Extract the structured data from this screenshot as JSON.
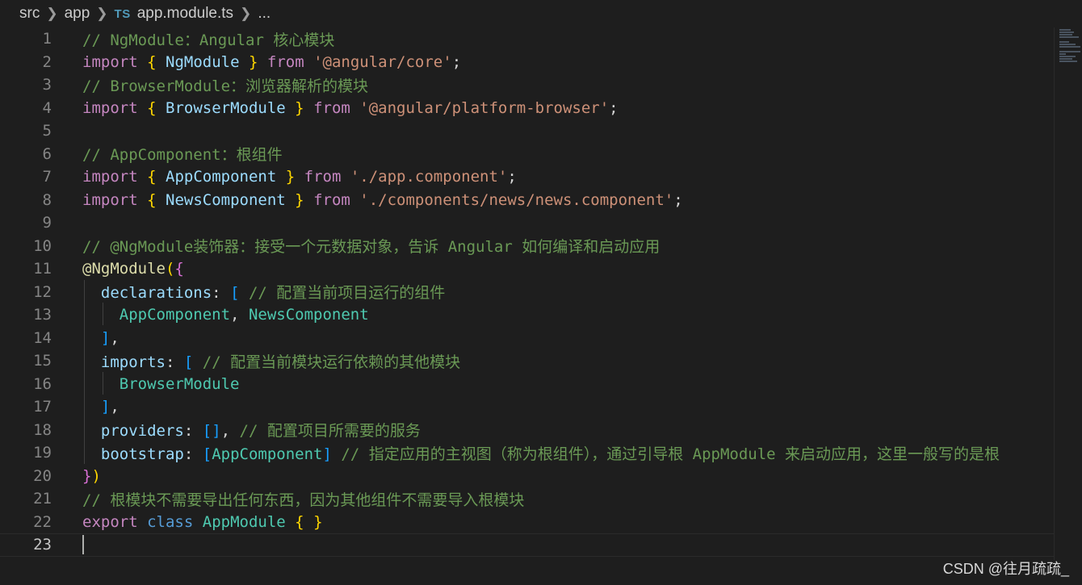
{
  "breadcrumb": {
    "seg1": "src",
    "seg2": "app",
    "file_icon": "TS",
    "file": "app.module.ts",
    "more": "..."
  },
  "gutter": {
    "numbers": [
      "1",
      "2",
      "3",
      "4",
      "5",
      "6",
      "7",
      "8",
      "9",
      "10",
      "11",
      "12",
      "13",
      "14",
      "15",
      "16",
      "17",
      "18",
      "19",
      "20",
      "21",
      "22",
      "23"
    ]
  },
  "code": {
    "l1": "// NgModule：Angular 核心模块",
    "l2": {
      "kw": "import",
      "ob": "{",
      "name": "NgModule",
      "cb": "}",
      "from": "from",
      "str": "'@angular/core'",
      "end": ";"
    },
    "l3": "// BrowserModule：浏览器解析的模块",
    "l4": {
      "kw": "import",
      "ob": "{",
      "name": "BrowserModule",
      "cb": "}",
      "from": "from",
      "str": "'@angular/platform-browser'",
      "end": ";"
    },
    "l6": "// AppComponent：根组件",
    "l7": {
      "kw": "import",
      "ob": "{",
      "name": "AppComponent",
      "cb": "}",
      "from": "from",
      "str": "'./app.component'",
      "end": ";"
    },
    "l8": {
      "kw": "import",
      "ob": "{",
      "name": "NewsComponent",
      "cb": "}",
      "from": "from",
      "str": "'./components/news/news.component'",
      "end": ";"
    },
    "l10": "// @NgModule装饰器：接受一个元数据对象，告诉 Angular 如何编译和启动应用",
    "l11": {
      "at": "@",
      "fn": "NgModule",
      "op": "(",
      "ob": "{"
    },
    "l12": {
      "prop": "declarations",
      "colon": ":",
      "br": "[",
      "cm": "// 配置当前项目运行的组件"
    },
    "l13": {
      "a": "AppComponent",
      "comma": ",",
      "b": "NewsComponent"
    },
    "l14": {
      "br": "]",
      "comma": ","
    },
    "l15": {
      "prop": "imports",
      "colon": ":",
      "br": "[",
      "cm": "// 配置当前模块运行依赖的其他模块"
    },
    "l16": {
      "a": "BrowserModule"
    },
    "l17": {
      "br": "]",
      "comma": ","
    },
    "l18": {
      "prop": "providers",
      "colon": ":",
      "br": "[]",
      "comma": ",",
      "cm": "// 配置项目所需要的服务"
    },
    "l19": {
      "prop": "bootstrap",
      "colon": ":",
      "ob": "[",
      "a": "AppComponent",
      "cb": "]",
      "cm": "// 指定应用的主视图（称为根组件），通过引导根 AppModule 来启动应用，这里一般写的是根"
    },
    "l20": {
      "cb": "}",
      "cp": ")"
    },
    "l21": "// 根模块不需要导出任何东西，因为其他组件不需要导入根模块",
    "l22": {
      "kw": "export",
      "kw2": "class",
      "name": "AppModule",
      "ob": "{",
      "cb": "}"
    }
  },
  "watermark": "CSDN @往月疏疏_",
  "colors": {
    "background": "#1e1e1e",
    "keyword": "#c586c0",
    "string": "#ce9178",
    "comment": "#6a9955",
    "identifier": "#9cdcfe",
    "class": "#4ec9b0"
  }
}
